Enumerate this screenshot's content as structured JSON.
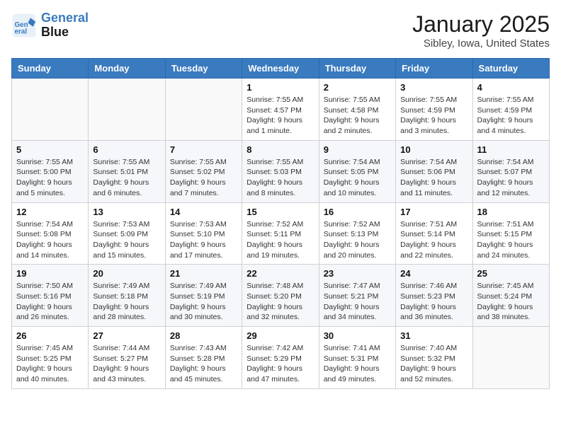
{
  "header": {
    "logo_line1": "General",
    "logo_line2": "Blue",
    "month": "January 2025",
    "location": "Sibley, Iowa, United States"
  },
  "weekdays": [
    "Sunday",
    "Monday",
    "Tuesday",
    "Wednesday",
    "Thursday",
    "Friday",
    "Saturday"
  ],
  "weeks": [
    [
      {
        "day": "",
        "info": ""
      },
      {
        "day": "",
        "info": ""
      },
      {
        "day": "",
        "info": ""
      },
      {
        "day": "1",
        "info": "Sunrise: 7:55 AM\nSunset: 4:57 PM\nDaylight: 9 hours\nand 1 minute."
      },
      {
        "day": "2",
        "info": "Sunrise: 7:55 AM\nSunset: 4:58 PM\nDaylight: 9 hours\nand 2 minutes."
      },
      {
        "day": "3",
        "info": "Sunrise: 7:55 AM\nSunset: 4:59 PM\nDaylight: 9 hours\nand 3 minutes."
      },
      {
        "day": "4",
        "info": "Sunrise: 7:55 AM\nSunset: 4:59 PM\nDaylight: 9 hours\nand 4 minutes."
      }
    ],
    [
      {
        "day": "5",
        "info": "Sunrise: 7:55 AM\nSunset: 5:00 PM\nDaylight: 9 hours\nand 5 minutes."
      },
      {
        "day": "6",
        "info": "Sunrise: 7:55 AM\nSunset: 5:01 PM\nDaylight: 9 hours\nand 6 minutes."
      },
      {
        "day": "7",
        "info": "Sunrise: 7:55 AM\nSunset: 5:02 PM\nDaylight: 9 hours\nand 7 minutes."
      },
      {
        "day": "8",
        "info": "Sunrise: 7:55 AM\nSunset: 5:03 PM\nDaylight: 9 hours\nand 8 minutes."
      },
      {
        "day": "9",
        "info": "Sunrise: 7:54 AM\nSunset: 5:05 PM\nDaylight: 9 hours\nand 10 minutes."
      },
      {
        "day": "10",
        "info": "Sunrise: 7:54 AM\nSunset: 5:06 PM\nDaylight: 9 hours\nand 11 minutes."
      },
      {
        "day": "11",
        "info": "Sunrise: 7:54 AM\nSunset: 5:07 PM\nDaylight: 9 hours\nand 12 minutes."
      }
    ],
    [
      {
        "day": "12",
        "info": "Sunrise: 7:54 AM\nSunset: 5:08 PM\nDaylight: 9 hours\nand 14 minutes."
      },
      {
        "day": "13",
        "info": "Sunrise: 7:53 AM\nSunset: 5:09 PM\nDaylight: 9 hours\nand 15 minutes."
      },
      {
        "day": "14",
        "info": "Sunrise: 7:53 AM\nSunset: 5:10 PM\nDaylight: 9 hours\nand 17 minutes."
      },
      {
        "day": "15",
        "info": "Sunrise: 7:52 AM\nSunset: 5:11 PM\nDaylight: 9 hours\nand 19 minutes."
      },
      {
        "day": "16",
        "info": "Sunrise: 7:52 AM\nSunset: 5:13 PM\nDaylight: 9 hours\nand 20 minutes."
      },
      {
        "day": "17",
        "info": "Sunrise: 7:51 AM\nSunset: 5:14 PM\nDaylight: 9 hours\nand 22 minutes."
      },
      {
        "day": "18",
        "info": "Sunrise: 7:51 AM\nSunset: 5:15 PM\nDaylight: 9 hours\nand 24 minutes."
      }
    ],
    [
      {
        "day": "19",
        "info": "Sunrise: 7:50 AM\nSunset: 5:16 PM\nDaylight: 9 hours\nand 26 minutes."
      },
      {
        "day": "20",
        "info": "Sunrise: 7:49 AM\nSunset: 5:18 PM\nDaylight: 9 hours\nand 28 minutes."
      },
      {
        "day": "21",
        "info": "Sunrise: 7:49 AM\nSunset: 5:19 PM\nDaylight: 9 hours\nand 30 minutes."
      },
      {
        "day": "22",
        "info": "Sunrise: 7:48 AM\nSunset: 5:20 PM\nDaylight: 9 hours\nand 32 minutes."
      },
      {
        "day": "23",
        "info": "Sunrise: 7:47 AM\nSunset: 5:21 PM\nDaylight: 9 hours\nand 34 minutes."
      },
      {
        "day": "24",
        "info": "Sunrise: 7:46 AM\nSunset: 5:23 PM\nDaylight: 9 hours\nand 36 minutes."
      },
      {
        "day": "25",
        "info": "Sunrise: 7:45 AM\nSunset: 5:24 PM\nDaylight: 9 hours\nand 38 minutes."
      }
    ],
    [
      {
        "day": "26",
        "info": "Sunrise: 7:45 AM\nSunset: 5:25 PM\nDaylight: 9 hours\nand 40 minutes."
      },
      {
        "day": "27",
        "info": "Sunrise: 7:44 AM\nSunset: 5:27 PM\nDaylight: 9 hours\nand 43 minutes."
      },
      {
        "day": "28",
        "info": "Sunrise: 7:43 AM\nSunset: 5:28 PM\nDaylight: 9 hours\nand 45 minutes."
      },
      {
        "day": "29",
        "info": "Sunrise: 7:42 AM\nSunset: 5:29 PM\nDaylight: 9 hours\nand 47 minutes."
      },
      {
        "day": "30",
        "info": "Sunrise: 7:41 AM\nSunset: 5:31 PM\nDaylight: 9 hours\nand 49 minutes."
      },
      {
        "day": "31",
        "info": "Sunrise: 7:40 AM\nSunset: 5:32 PM\nDaylight: 9 hours\nand 52 minutes."
      },
      {
        "day": "",
        "info": ""
      }
    ]
  ]
}
